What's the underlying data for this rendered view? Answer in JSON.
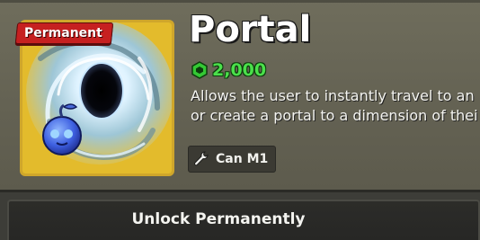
{
  "item": {
    "badge": "Permanent",
    "name": "Portal",
    "price": "2,000",
    "price_currency_icon": "robux-icon",
    "price_color": "#4be04b",
    "description_line1": "Allows the user to instantly travel to an",
    "description_line2": "or create a portal to a dimension of thei",
    "tag_icon": "wrench-icon",
    "tag_label": "Can M1",
    "frame_color": "#e3bb2c",
    "badge_color": "#c62020"
  },
  "actions": {
    "unlock_label": "Unlock Permanently"
  }
}
